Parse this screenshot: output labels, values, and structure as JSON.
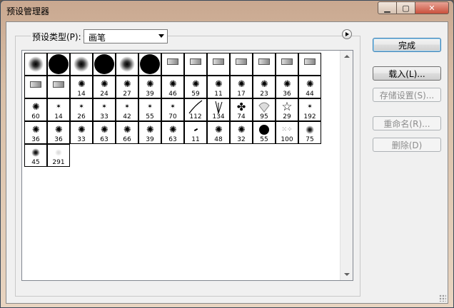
{
  "window": {
    "title": "预设管理器",
    "close_symbol": "✕",
    "max_symbol": "▢",
    "min_symbol": "▁"
  },
  "preset_type": {
    "label": "预设类型(P):",
    "value": "画笔"
  },
  "buttons": {
    "done": "完成",
    "load": "载入(L)...",
    "save_set": "存储设置(S)...",
    "rename": "重命名(R)...",
    "delete": "删除(D)"
  },
  "brushes": [
    {
      "kind": "soft",
      "num": ""
    },
    {
      "kind": "hard",
      "num": ""
    },
    {
      "kind": "soft",
      "num": ""
    },
    {
      "kind": "hard",
      "num": ""
    },
    {
      "kind": "soft",
      "num": ""
    },
    {
      "kind": "hard",
      "num": ""
    },
    {
      "kind": "tip",
      "num": ""
    },
    {
      "kind": "tip",
      "num": ""
    },
    {
      "kind": "tip",
      "num": ""
    },
    {
      "kind": "tip",
      "num": ""
    },
    {
      "kind": "tip",
      "num": ""
    },
    {
      "kind": "tip",
      "num": ""
    },
    {
      "kind": "tip",
      "num": ""
    },
    {
      "kind": "tip",
      "num": ""
    },
    {
      "kind": "tip",
      "num": ""
    },
    {
      "kind": "splat",
      "num": "14"
    },
    {
      "kind": "splat",
      "num": "24"
    },
    {
      "kind": "splat",
      "num": "27"
    },
    {
      "kind": "splat",
      "num": "39"
    },
    {
      "kind": "splat",
      "num": "46"
    },
    {
      "kind": "splat",
      "num": "59"
    },
    {
      "kind": "splat",
      "num": "11"
    },
    {
      "kind": "splat",
      "num": "17"
    },
    {
      "kind": "splat",
      "num": "23"
    },
    {
      "kind": "splat",
      "num": "36"
    },
    {
      "kind": "splat",
      "num": "44"
    },
    {
      "kind": "splat",
      "num": "60"
    },
    {
      "kind": "small",
      "num": "14"
    },
    {
      "kind": "small",
      "num": "26"
    },
    {
      "kind": "small",
      "num": "33"
    },
    {
      "kind": "small",
      "num": "42"
    },
    {
      "kind": "small",
      "num": "55"
    },
    {
      "kind": "small",
      "num": "70"
    },
    {
      "kind": "line",
      "num": "112"
    },
    {
      "kind": "grass",
      "num": "134"
    },
    {
      "kind": "leaf",
      "num": "74"
    },
    {
      "kind": "shell",
      "num": "95"
    },
    {
      "kind": "star",
      "num": "29"
    },
    {
      "kind": "small",
      "num": "192"
    },
    {
      "kind": "splat",
      "num": "36"
    },
    {
      "kind": "splat",
      "num": "36"
    },
    {
      "kind": "splat",
      "num": "33"
    },
    {
      "kind": "splat",
      "num": "63"
    },
    {
      "kind": "splat",
      "num": "66"
    },
    {
      "kind": "splat",
      "num": "39"
    },
    {
      "kind": "splat",
      "num": "63"
    },
    {
      "kind": "dash",
      "num": "11"
    },
    {
      "kind": "splat",
      "num": "48"
    },
    {
      "kind": "splat",
      "num": "32"
    },
    {
      "kind": "hardsm",
      "num": "55"
    },
    {
      "kind": "dots",
      "num": "100"
    },
    {
      "kind": "softsm",
      "num": "75"
    },
    {
      "kind": "softsm",
      "num": "45"
    },
    {
      "kind": "faint",
      "num": "291"
    }
  ]
}
